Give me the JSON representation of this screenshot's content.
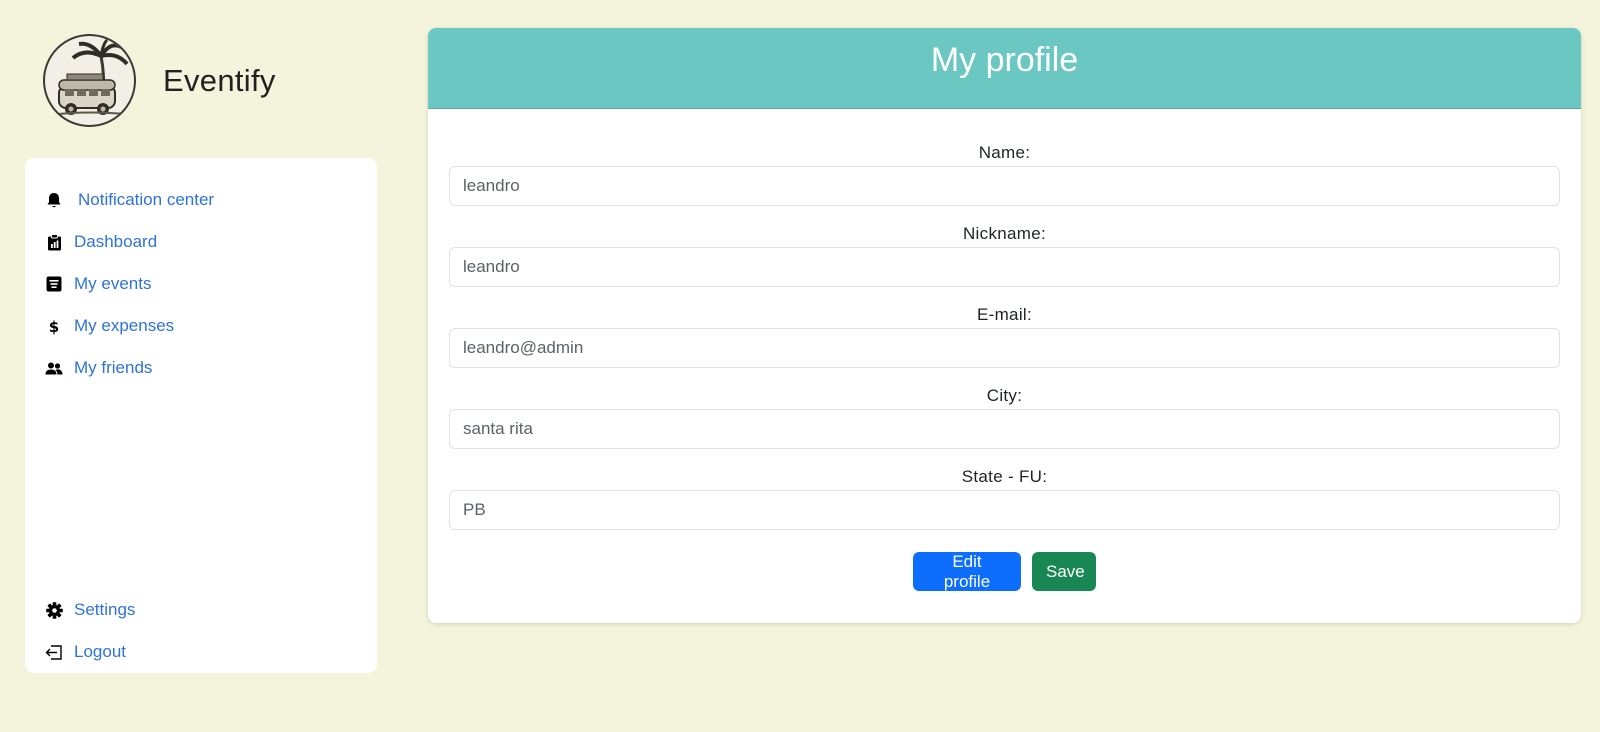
{
  "brand": {
    "name": "Eventify"
  },
  "sidebar": {
    "items": [
      {
        "label": "Notification center",
        "icon": "bell-icon"
      },
      {
        "label": "Dashboard",
        "icon": "clipboard-chart-icon"
      },
      {
        "label": "My events",
        "icon": "event-list-icon"
      },
      {
        "label": "My expenses",
        "icon": "dollar-icon"
      },
      {
        "label": "My friends",
        "icon": "people-icon"
      }
    ],
    "bottom": [
      {
        "label": "Settings",
        "icon": "gear-icon"
      },
      {
        "label": "Logout",
        "icon": "logout-icon"
      }
    ]
  },
  "profile": {
    "title": "My profile",
    "fields": [
      {
        "label": "Name:",
        "value": "leandro"
      },
      {
        "label": "Nickname:",
        "value": "leandro"
      },
      {
        "label": "E-mail:",
        "value": "leandro@admin"
      },
      {
        "label": "City:",
        "value": "santa rita"
      },
      {
        "label": "State - FU:",
        "value": "PB"
      }
    ],
    "edit_label": "Edit profile",
    "save_label": "Save"
  },
  "colors": {
    "page_bg": "#f4f4dc",
    "header_bg": "#6bc7c1",
    "link": "#2f73d9",
    "primary": "#0d6efd",
    "success": "#198754"
  }
}
